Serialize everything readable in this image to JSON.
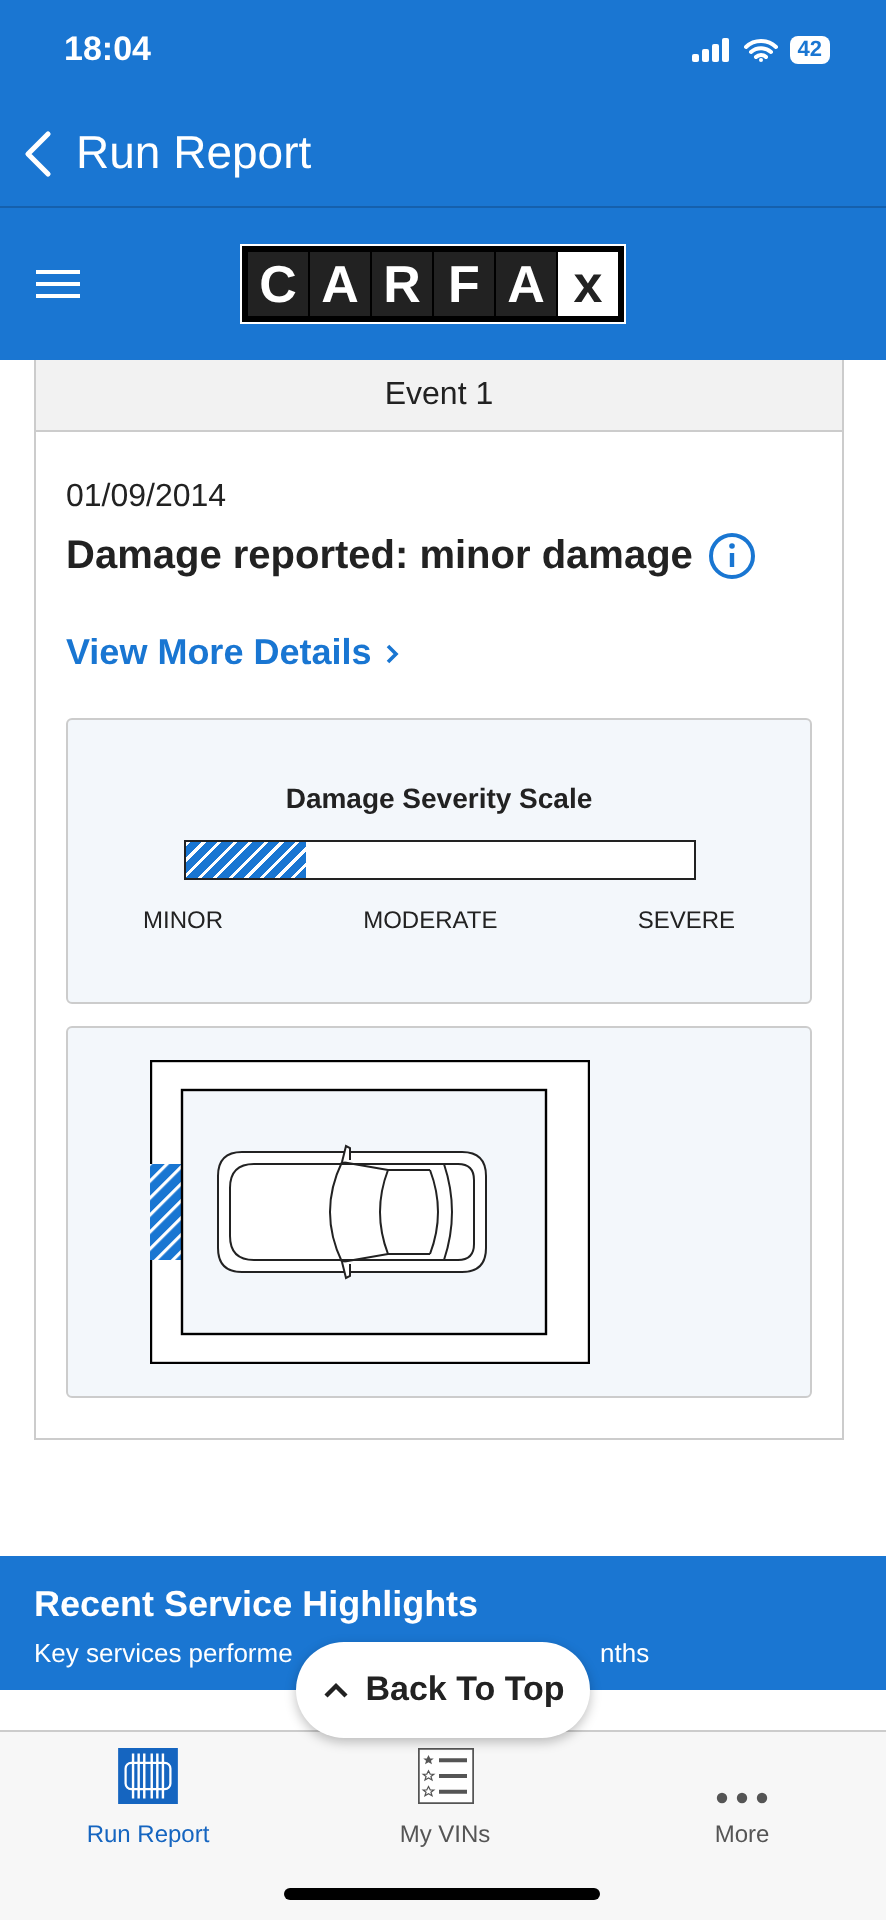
{
  "status_bar": {
    "time": "18:04",
    "battery": "42"
  },
  "nav": {
    "title": "Run Report"
  },
  "logo": {
    "letters": [
      "C",
      "A",
      "R",
      "F",
      "A",
      "x"
    ]
  },
  "event": {
    "header": "Event 1",
    "date": "01/09/2014",
    "title": "Damage reported: minor damage",
    "link": "View More Details",
    "severity": {
      "title": "Damage Severity Scale",
      "level": 0.24,
      "labels": [
        "MINOR",
        "MODERATE",
        "SEVERE"
      ]
    }
  },
  "banner": {
    "title": "Recent Service Highlights",
    "subtitle_parts": [
      "Key services performe",
      "nths"
    ]
  },
  "back_to_top": "Back To Top",
  "tabs": [
    {
      "label": "Run Report",
      "kind": "report",
      "selected": true
    },
    {
      "label": "My VINs",
      "kind": "vins",
      "selected": false
    },
    {
      "label": "More",
      "kind": "more",
      "selected": false
    }
  ]
}
